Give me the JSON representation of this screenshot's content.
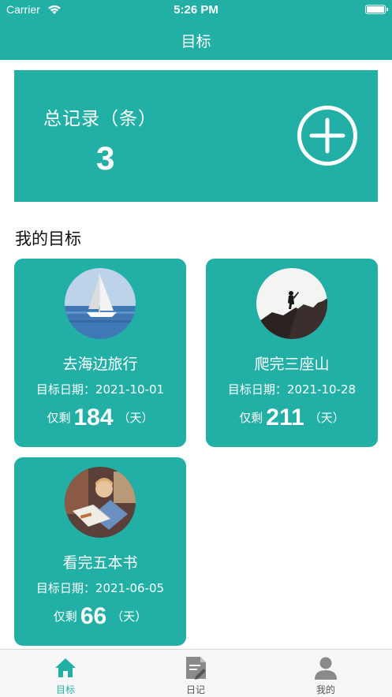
{
  "status_bar": {
    "carrier": "Carrier",
    "time": "5:26 PM"
  },
  "nav": {
    "title": "目标"
  },
  "summary": {
    "label": "总记录（条）",
    "count": "3",
    "add_icon": "plus-circle-icon"
  },
  "section": {
    "title": "我的目标"
  },
  "goals": [
    {
      "name": "去海边旅行",
      "date": "目标日期：2021-10-01",
      "remaining_prefix": "仅剩",
      "remaining_days": "184",
      "remaining_suffix": "（天）",
      "image": "sailboat-photo"
    },
    {
      "name": "爬完三座山",
      "date": "目标日期：2021-10-28",
      "remaining_prefix": "仅剩",
      "remaining_days": "211",
      "remaining_suffix": "（天）",
      "image": "hiker-photo"
    },
    {
      "name": "看完五本书",
      "date": "目标日期：2021-06-05",
      "remaining_prefix": "仅剩",
      "remaining_days": "66",
      "remaining_suffix": "（天）",
      "image": "child-reading-photo"
    }
  ],
  "tabs": [
    {
      "label": "目标",
      "icon": "home-icon",
      "active": true
    },
    {
      "label": "日记",
      "icon": "diary-icon",
      "active": false
    },
    {
      "label": "我的",
      "icon": "person-icon",
      "active": false
    }
  ],
  "colors": {
    "primary": "#22b0a6",
    "active_tab": "#22b0a6",
    "inactive_tab": "#888888",
    "background": "#ffffff"
  }
}
